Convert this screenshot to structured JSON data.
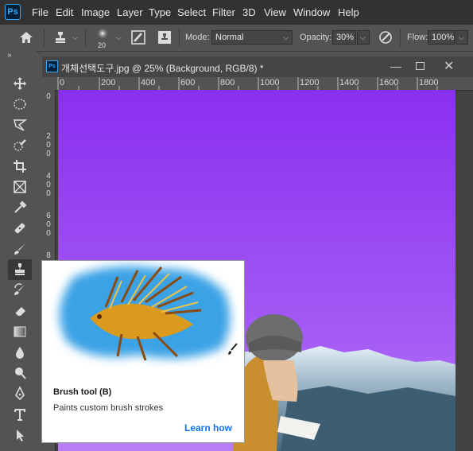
{
  "app": {
    "logo_text": "Ps"
  },
  "menu": [
    "File",
    "Edit",
    "Image",
    "Layer",
    "Type",
    "Select",
    "Filter",
    "3D",
    "View",
    "Window",
    "Help"
  ],
  "options": {
    "brush_size": "20",
    "mode_label": "Mode:",
    "mode_value": "Normal",
    "opacity_label": "Opacity:",
    "opacity_value": "30%",
    "flow_label": "Flow:",
    "flow_value": "100%"
  },
  "document": {
    "tab_title": "개체선택도구.jpg @ 25% (Background, RGB/8) *",
    "ruler_top": [
      "0",
      "200",
      "400",
      "600",
      "800",
      "1000",
      "1200",
      "1400",
      "1600",
      "1800"
    ],
    "ruler_left": [
      "0",
      "2\n0\n0",
      "4\n0\n0",
      "6\n0\n0",
      "8"
    ]
  },
  "tooltip": {
    "title": "Brush tool (B)",
    "description": "Paints custom brush strokes",
    "link": "Learn how"
  },
  "tools": [
    "move-tool",
    "marquee-tool",
    "lasso-tool",
    "quick-selection-tool",
    "crop-tool",
    "frame-tool",
    "eyedropper-tool",
    "healing-brush-tool",
    "brush-tool",
    "clone-stamp-tool",
    "history-brush-tool",
    "eraser-tool",
    "gradient-tool",
    "blur-tool",
    "dodge-tool",
    "pen-tool",
    "type-tool",
    "path-selection-tool"
  ],
  "colors": {
    "canvas_purple": "#8f3bf2",
    "link_blue": "#1473e6",
    "ps_blue": "#31a8ff"
  }
}
